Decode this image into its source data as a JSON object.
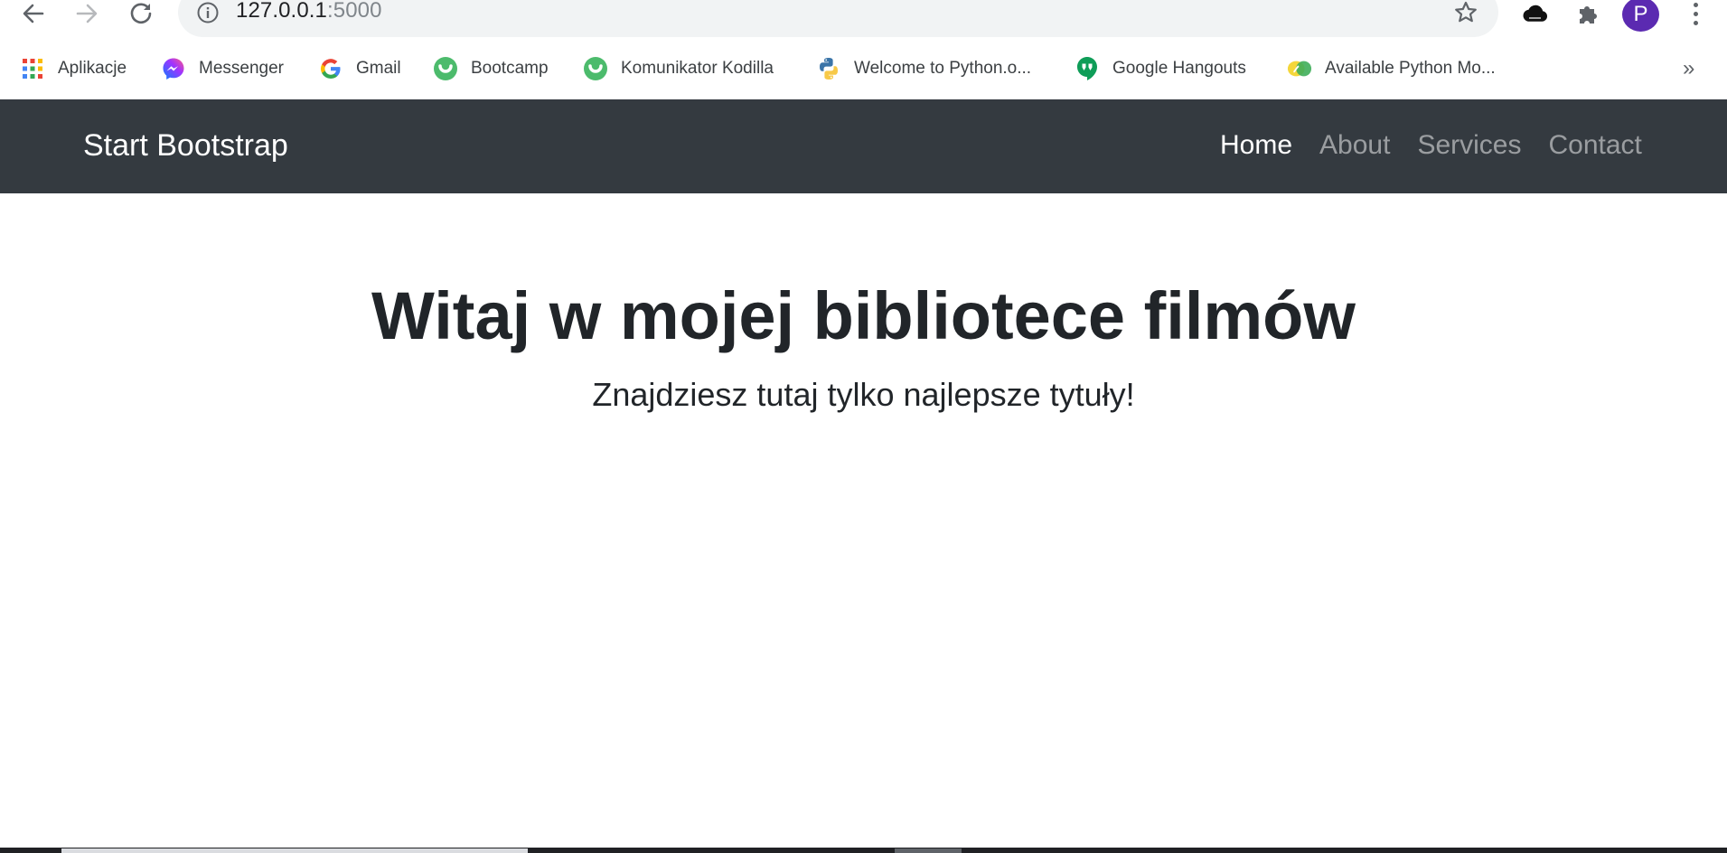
{
  "browser": {
    "url_host": "127.0.0.1",
    "url_port": ":5000",
    "profile_initial": "P",
    "accent_color": "#5b2ab1"
  },
  "bookmarks": {
    "items": [
      {
        "label": "Aplikacje",
        "icon": "apps-grid-icon"
      },
      {
        "label": "Messenger",
        "icon": "messenger-icon"
      },
      {
        "label": "Gmail",
        "icon": "google-icon"
      },
      {
        "label": "Bootcamp",
        "icon": "kodilla-icon"
      },
      {
        "label": "Komunikator Kodilla",
        "icon": "kodilla-icon"
      },
      {
        "label": "Welcome to Python.o...",
        "icon": "python-icon"
      },
      {
        "label": "Google Hangouts",
        "icon": "hangouts-icon"
      },
      {
        "label": "Available Python Mo...",
        "icon": "python-modules-icon"
      }
    ],
    "more_label": "»"
  },
  "navbar": {
    "brand": "Start Bootstrap",
    "links": [
      {
        "label": "Home",
        "active": true
      },
      {
        "label": "About",
        "active": false
      },
      {
        "label": "Services",
        "active": false
      },
      {
        "label": "Contact",
        "active": false
      }
    ],
    "bg_color": "#343a40"
  },
  "hero": {
    "title": "Witaj w mojej bibliotece filmów",
    "lead": "Znajdziesz tutaj tylko najlepsze tytuły!"
  }
}
